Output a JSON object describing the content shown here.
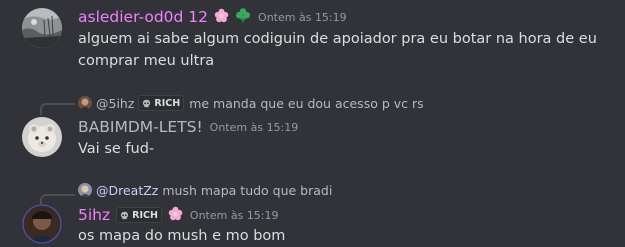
{
  "messages": [
    {
      "author": "asledier-od0d 12",
      "author_color": "#f47fff",
      "badges": [
        "flower-badge",
        "clover-badge"
      ],
      "timestamp": "Ontem às 15:19",
      "lines": [
        "alguem ai sabe algum codiguin de apoiador pra eu botar na hora de eu",
        "comprar meu ultra"
      ]
    },
    {
      "reply": {
        "author": "@5ihz",
        "tag": "RICH",
        "text": "me manda que eu dou acesso p vc rs"
      },
      "author": "BABIMDM-LETS!",
      "author_color": "#b5bac1",
      "timestamp": "Ontem às 15:19",
      "lines": [
        "Vai se fud-"
      ]
    },
    {
      "reply": {
        "author": "@DreatZz",
        "text": "mush mapa tudo que bradi"
      },
      "author": "5ihz",
      "author_color": "#f47fff",
      "tag": "RICH",
      "badges": [
        "flower-badge"
      ],
      "timestamp": "Ontem às 15:19",
      "lines": [
        "os mapa do mush e mo bom"
      ]
    }
  ],
  "colors": {
    "background": "#313338",
    "text": "#dbdee1",
    "muted": "#949ba4",
    "reply_mention": "#c9cdfb",
    "flower": "#f9a8d4",
    "clover": "#3ba55c"
  }
}
